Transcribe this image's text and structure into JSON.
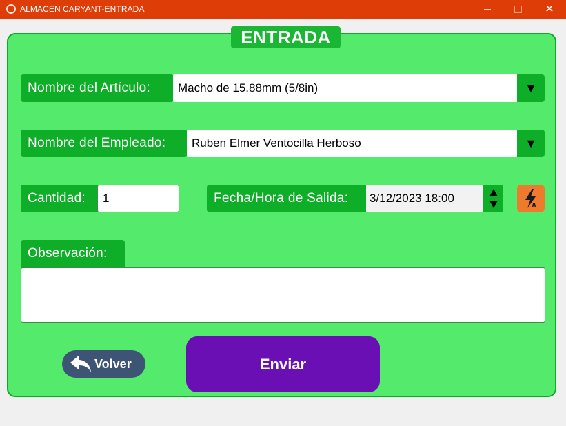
{
  "window": {
    "title": "ALMACEN CARYANT-ENTRADA",
    "minimize_icon": "minimize-icon",
    "maximize_icon": "maximize-icon",
    "close_label": "✕"
  },
  "form": {
    "title": "ENTRADA",
    "article": {
      "label": "Nombre del Artículo:",
      "value": "Macho de 15.88mm (5/8in)",
      "arrow": "▼"
    },
    "employee": {
      "label": "Nombre del Empleado:",
      "value": "Ruben Elmer Ventocilla Herboso",
      "arrow": "▼"
    },
    "quantity": {
      "label": "Cantidad:",
      "value": "1"
    },
    "datetime": {
      "label": "Fecha/Hora de Salida:",
      "value": "3/12/2023 18:00"
    },
    "auto_button_icon": "lightning-icon",
    "observation": {
      "label": "Observación:",
      "value": ""
    }
  },
  "buttons": {
    "back_label": "Volver",
    "send_label": "Enviar"
  },
  "colors": {
    "titlebar": "#df3d08",
    "panel": "#54eb6c",
    "label_bg": "#0fae28",
    "send_button": "#6a0fb3",
    "back_button": "#3e5475",
    "auto_button": "#ee7a2e"
  }
}
